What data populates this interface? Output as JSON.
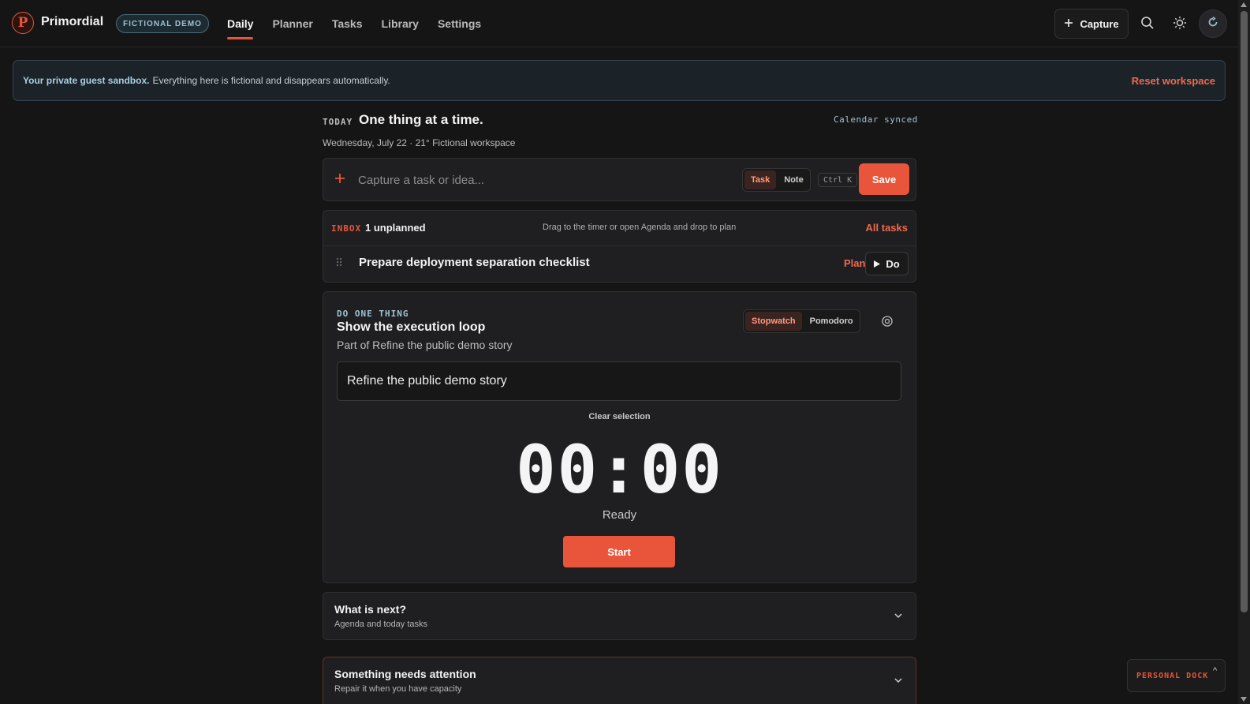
{
  "app": {
    "brand": "Primordial",
    "logo_letter": "P",
    "demo_badge": "FICTIONAL DEMO"
  },
  "nav": {
    "items": [
      {
        "label": "Daily",
        "active": true
      },
      {
        "label": "Planner",
        "active": false
      },
      {
        "label": "Tasks",
        "active": false
      },
      {
        "label": "Library",
        "active": false
      },
      {
        "label": "Settings",
        "active": false
      }
    ]
  },
  "topbar": {
    "capture_label": "Capture"
  },
  "banner": {
    "strong": "Your private guest sandbox.",
    "text": "Everything here is fictional and disappears automatically.",
    "reset": "Reset workspace"
  },
  "today": {
    "label": "TODAY",
    "title": "One thing at a time.",
    "calendar_status": "Calendar synced",
    "subtitle": "Wednesday, July 22 · 21° Fictional workspace"
  },
  "capture": {
    "placeholder": "Capture a task or idea...",
    "modes": [
      "Task",
      "Note"
    ],
    "shortcut": "Ctrl K",
    "save": "Save"
  },
  "inbox": {
    "label": "INBOX",
    "count": "1 unplanned",
    "hint": "Drag to the timer or open Agenda and drop to plan",
    "all_tasks": "All tasks",
    "tasks": [
      {
        "title": "Prepare deployment separation checklist",
        "plan": "Plan",
        "do": "Do"
      }
    ]
  },
  "focus": {
    "label": "DO ONE THING",
    "title": "Show the execution loop",
    "subtitle": "Part of Refine the public demo story",
    "modes": [
      "Stopwatch",
      "Pomodoro"
    ],
    "project": "Refine the public demo story",
    "clear": "Clear selection",
    "timer": "00:00",
    "status": "Ready",
    "start": "Start"
  },
  "sections": {
    "next": {
      "title": "What is next?",
      "subtitle": "Agenda and today tasks"
    },
    "attention": {
      "title": "Something needs attention",
      "subtitle": "Repair it when you have capacity"
    }
  },
  "dock": {
    "label": "PERSONAL DOCK",
    "caret": "^"
  },
  "colors": {
    "accent": "#e8553a",
    "info": "#9fc3d4",
    "background": "#151515",
    "card": "#1f1f22"
  }
}
